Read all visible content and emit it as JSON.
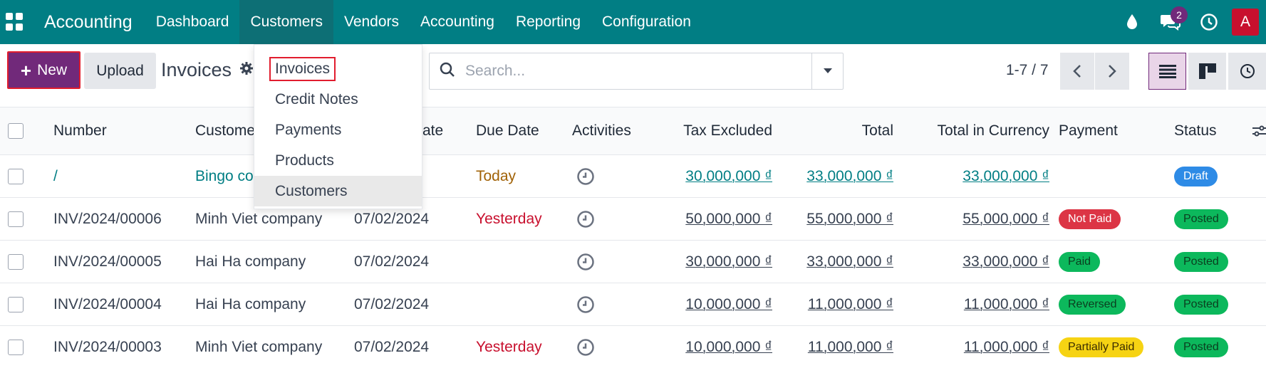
{
  "app": {
    "title": "Accounting"
  },
  "menu": [
    "Dashboard",
    "Customers",
    "Vendors",
    "Accounting",
    "Reporting",
    "Configuration"
  ],
  "topbar": {
    "messages_count": "2",
    "avatar_letter": "A"
  },
  "control": {
    "new_label": "New",
    "upload_label": "Upload",
    "page_title": "Invoices",
    "search_placeholder": "Search...",
    "pager": "1-7 / 7"
  },
  "dropdown": [
    "Invoices",
    "Credit Notes",
    "Payments",
    "Products",
    "Customers"
  ],
  "table": {
    "headers": {
      "number": "Number",
      "customer": "Custome",
      "date": "ate",
      "due": "Due Date",
      "activities": "Activities",
      "tax_excluded": "Tax Excluded",
      "total": "Total",
      "total_currency": "Total in Currency",
      "payment": "Payment",
      "status": "Status"
    },
    "rows": [
      {
        "number": "/",
        "customer": "Bingo co",
        "date": "",
        "due": "Today",
        "tax": "30,000,000 ₫",
        "total": "33,000,000 ₫",
        "total_cur": "33,000,000 ₫",
        "payment": "",
        "status": "Draft"
      },
      {
        "number": "INV/2024/00006",
        "customer": "Minh Viet company",
        "date": "07/02/2024",
        "due": "Yesterday",
        "tax": "50,000,000 ₫",
        "total": "55,000,000 ₫",
        "total_cur": "55,000,000 ₫",
        "payment": "Not Paid",
        "status": "Posted"
      },
      {
        "number": "INV/2024/00005",
        "customer": "Hai Ha company",
        "date": "07/02/2024",
        "due": "",
        "tax": "30,000,000 ₫",
        "total": "33,000,000 ₫",
        "total_cur": "33,000,000 ₫",
        "payment": "Paid",
        "status": "Posted"
      },
      {
        "number": "INV/2024/00004",
        "customer": "Hai Ha company",
        "date": "07/02/2024",
        "due": "",
        "tax": "10,000,000 ₫",
        "total": "11,000,000 ₫",
        "total_cur": "11,000,000 ₫",
        "payment": "Reversed",
        "status": "Posted"
      },
      {
        "number": "INV/2024/00003",
        "customer": "Minh Viet company",
        "date": "07/02/2024",
        "due": "Yesterday",
        "tax": "10,000,000 ₫",
        "total": "11,000,000 ₫",
        "total_cur": "11,000,000 ₫",
        "payment": "Partially Paid",
        "status": "Posted"
      }
    ]
  },
  "colors": {
    "brand_bar": "#017e84",
    "primary": "#71297a",
    "highlight_box": "#e11d2e"
  }
}
